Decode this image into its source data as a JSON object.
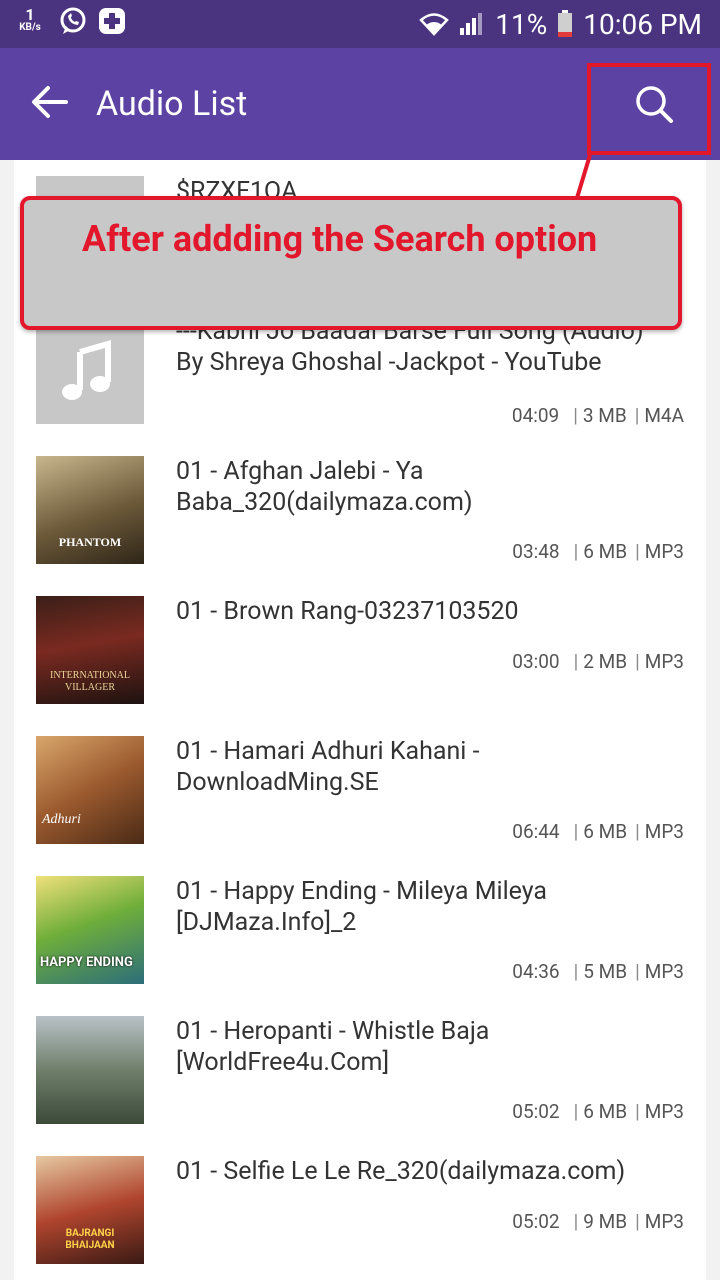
{
  "status_bar": {
    "net_speed_value": "1",
    "net_speed_unit": "KB/s",
    "battery": "11%",
    "time": "10:06 PM"
  },
  "app_bar": {
    "title": "Audio List"
  },
  "callout": {
    "text": "After addding the Search option"
  },
  "tracks": [
    {
      "title_line1": "$RZXF1QA",
      "title_line2": "",
      "duration": "",
      "size": "",
      "format": ""
    },
    {
      "title_line1": "---Kabhi Jo Baadal Barse Full Song (Audio)",
      "title_line2": "By Shreya Ghoshal -Jackpot - YouTube",
      "duration": "04:09",
      "size": "3 MB",
      "format": "M4A"
    },
    {
      "title_line1": "01 - Afghan Jalebi - Ya",
      "title_line2": "Baba_320(dailymaza.com)",
      "duration": "03:48",
      "size": "6 MB",
      "format": "MP3",
      "art_label": "PHANTOM"
    },
    {
      "title_line1": "01 - Brown Rang-03237103520",
      "title_line2": "",
      "duration": "03:00",
      "size": "2 MB",
      "format": "MP3",
      "art_label": "INTERNATIONAL VILLAGER"
    },
    {
      "title_line1": "01 - Hamari Adhuri Kahani -",
      "title_line2": "DownloadMing.SE",
      "duration": "06:44",
      "size": "6 MB",
      "format": "MP3",
      "art_label": "Adhuri"
    },
    {
      "title_line1": "01 - Happy Ending - Mileya Mileya",
      "title_line2": "[DJMaza.Info]_2",
      "duration": "04:36",
      "size": "5 MB",
      "format": "MP3",
      "art_label": "HAPPY ENDING"
    },
    {
      "title_line1": "01 - Heropanti - Whistle Baja",
      "title_line2": "[WorldFree4u.Com]",
      "duration": "05:02",
      "size": "6 MB",
      "format": "MP3"
    },
    {
      "title_line1": "01 - Selfie Le Le Re_320(dailymaza.com)",
      "title_line2": "",
      "duration": "05:02",
      "size": "9 MB",
      "format": "MP3",
      "art_label": "BAJRANGI BHAIJAAN"
    }
  ],
  "colors": {
    "status_bar": "#4a347f",
    "app_bar": "#5c43a3",
    "highlight_red": "#e3172b",
    "callout_bg": "#c8c8c8",
    "list_bg": "#ffffff"
  },
  "icons": [
    "back-arrow-icon",
    "search-icon",
    "music-note-icon",
    "whatsapp-icon",
    "plus-icon",
    "wifi-icon",
    "signal-icon",
    "battery-icon"
  ]
}
